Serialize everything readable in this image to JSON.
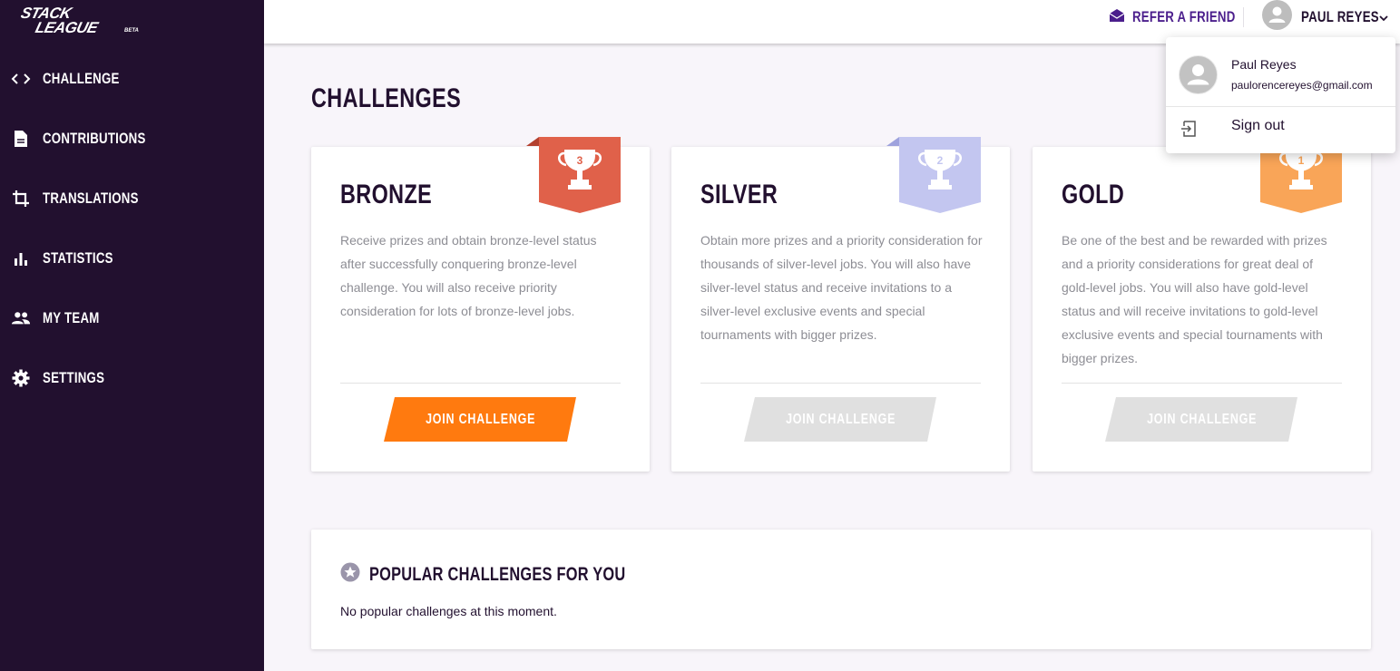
{
  "app": {
    "logo_text_1": "STACK",
    "logo_text_2": "LEAGUE",
    "logo_tag": "BETA"
  },
  "sidebar": {
    "items": [
      {
        "label": "CHALLENGE",
        "icon": "code-icon"
      },
      {
        "label": "CONTRIBUTIONS",
        "icon": "document-icon"
      },
      {
        "label": "TRANSLATIONS",
        "icon": "crop-icon"
      },
      {
        "label": "STATISTICS",
        "icon": "bar-chart-icon"
      },
      {
        "label": "MY TEAM",
        "icon": "people-icon"
      },
      {
        "label": "SETTINGS",
        "icon": "gear-icon"
      }
    ]
  },
  "topbar": {
    "refer_label": "REFER A FRIEND",
    "user_name": "PAUL REYES"
  },
  "page": {
    "title": "CHALLENGES"
  },
  "challenges": [
    {
      "tier": "BRONZE",
      "rank": "3",
      "description": "Receive prizes and obtain bronze-level status after successfully conquering bronze-level challenge. You will also receive priority consideration for lots of bronze-level jobs.",
      "button_label": "JOIN CHALLENGE",
      "enabled": true
    },
    {
      "tier": "SILVER",
      "rank": "2",
      "description": "Obtain more prizes and a priority consideration for thousands of silver-level jobs. You will also have silver-level status and receive invitations to a silver-level exclusive events and special tournaments with bigger prizes.",
      "button_label": "JOIN CHALLENGE",
      "enabled": false
    },
    {
      "tier": "GOLD",
      "rank": "1",
      "description": "Be one of the best and be rewarded with prizes and a priority considerations for great deal of gold-level jobs. You will also have gold-level status and will receive invitations to gold-level exclusive events and special tournaments with bigger prizes.",
      "button_label": "JOIN CHALLENGE",
      "enabled": false
    }
  ],
  "popular": {
    "title": "POPULAR CHALLENGES FOR YOU",
    "empty_text": "No popular challenges at this moment."
  },
  "dropdown": {
    "name": "Paul Reyes",
    "email": "paulorencereyes@gmail.com",
    "signout_label": "Sign out"
  },
  "colors": {
    "sidebar_bg": "#22102f",
    "accent_orange": "#ff7a0f",
    "bronze_badge": "#e0614a",
    "silver_badge": "#c3c6f0",
    "gold_badge": "#f9a558",
    "disabled_button": "#e0e0e0",
    "refer_purple": "#4b1e8c"
  }
}
